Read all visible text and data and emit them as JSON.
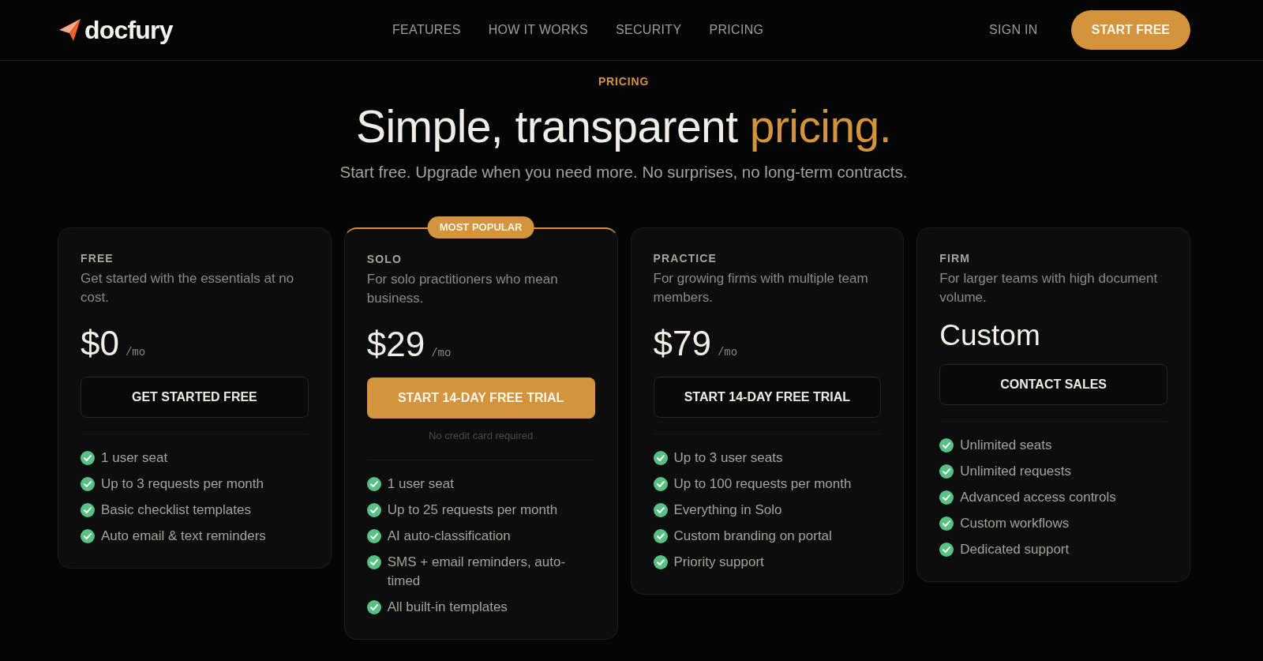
{
  "nav": {
    "logo": "docfury",
    "links": [
      "FEATURES",
      "HOW IT WORKS",
      "SECURITY",
      "PRICING"
    ],
    "sign_in": "SIGN IN",
    "cta": "START FREE"
  },
  "hero": {
    "eyebrow": "PRICING",
    "title": "Simple, transparent",
    "title_accent": "pricing.",
    "subtitle": "Start free. Upgrade when you need more. No surprises, no long-term contracts."
  },
  "plans": [
    {
      "name": "FREE",
      "description": "Get started with the essentials at no cost.",
      "price": "$0",
      "period": "/mo",
      "button": "GET STARTED FREE",
      "featured": false,
      "features": [
        "1 user seat",
        "Up to 3 requests per month",
        "Basic checklist templates",
        "Auto email & text reminders"
      ]
    },
    {
      "name": "SOLO",
      "badge": "MOST POPULAR",
      "description": "For solo practitioners who mean business.",
      "price": "$29",
      "period": "/mo",
      "button": "START 14-DAY FREE TRIAL",
      "featured": true,
      "note": "No credit card required",
      "features": [
        "1 user seat",
        "Up to 25 requests per month",
        "AI auto-classification",
        "SMS + email reminders, auto-timed",
        "All built-in templates"
      ]
    },
    {
      "name": "PRACTICE",
      "description": "For growing firms with multiple team members.",
      "price": "$79",
      "period": "/mo",
      "button": "START 14-DAY FREE TRIAL",
      "featured": false,
      "features": [
        "Up to 3 user seats",
        "Up to 100 requests per month",
        "Everything in Solo",
        "Custom branding on portal",
        "Priority support"
      ]
    },
    {
      "name": "FIRM",
      "description": "For larger teams with high document volume.",
      "price": "Custom",
      "button": "CONTACT SALES",
      "featured": false,
      "features": [
        "Unlimited seats",
        "Unlimited requests",
        "Advanced access controls",
        "Custom workflows",
        "Dedicated support"
      ]
    }
  ]
}
